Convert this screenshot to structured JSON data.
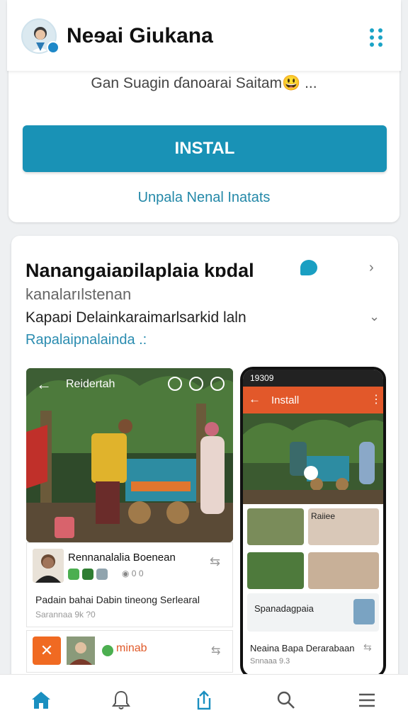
{
  "header": {
    "app_title": "Neɘai Giukana",
    "avatar_icon": "profile-avatar",
    "menu_icon": "grid-dots-icon"
  },
  "promo": {
    "subtitle": "Gan Suagin ɗanoarai Saitam😃 ...",
    "install_label": "INSTAL",
    "link_label": "Unpala Nenal Inatats"
  },
  "feature_card": {
    "title": "Nanangaiaɒilaplaia kɒdal",
    "subtitle": "kanalarılstenan",
    "description": "Kapaɒi Delainkaraimarlsarkid laln",
    "link": "Rapalaipnalainda .:",
    "screenshot_title": "Reidertah",
    "row_card": {
      "name": "Rennanalalia  Boenean",
      "stats": "◉ 0 0",
      "line": "Padain bahai Dabin tineong Serlearal",
      "meta": "Sarannaa 9k ?0"
    },
    "bottom_card": {
      "name": "minab"
    }
  },
  "phone": {
    "status_time": "19309",
    "bar_title": "Install",
    "tile_label": "Raiiee",
    "section_title": "Spanadagpaia",
    "item_title": "Neaina Bapa Derarabaan",
    "item_meta": "Snnaaa 9.3"
  },
  "colors": {
    "accent": "#1992b6",
    "orange": "#e2582a",
    "link": "#2388a8"
  },
  "nav": {
    "items": [
      "home-icon",
      "notifications-icon",
      "share-icon",
      "search-icon",
      "menu-icon"
    ]
  }
}
